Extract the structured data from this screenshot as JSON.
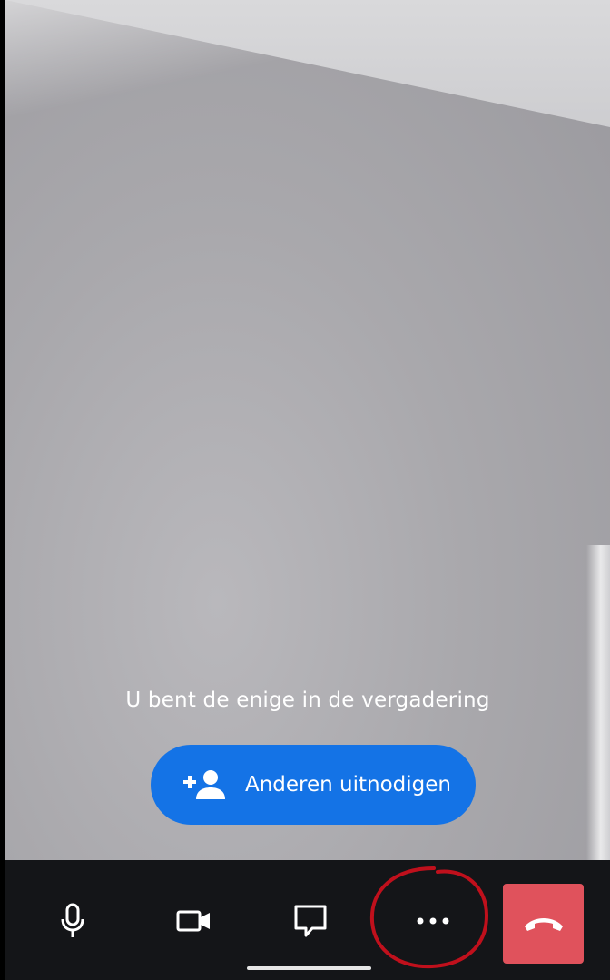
{
  "meeting": {
    "status_text": "U bent de enige in de vergadering",
    "invite_label": "Anderen uitnodigen"
  },
  "toolbar": {
    "icons": [
      "microphone-icon",
      "video-camera-icon",
      "chat-icon",
      "more-options-icon",
      "hang-up-icon"
    ]
  },
  "colors": {
    "invite_button": "#1473e6",
    "hangup_button": "#e0525c",
    "toolbar_bg": "#141518",
    "annotation": "#c0101c"
  }
}
